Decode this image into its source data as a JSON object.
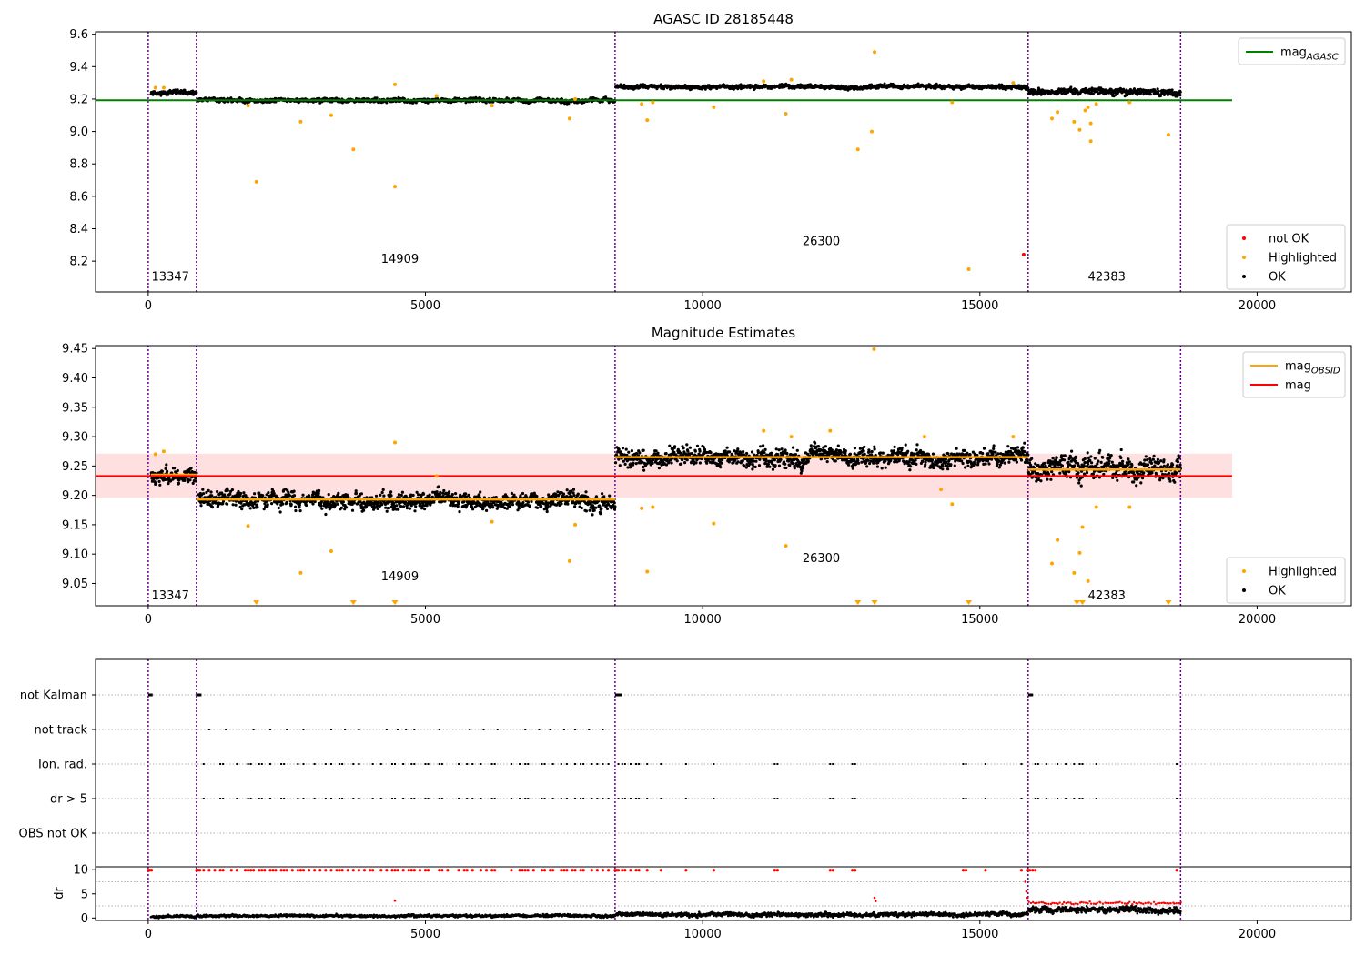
{
  "chart_data": [
    {
      "type": "scatter",
      "title": "AGASC ID 28185448",
      "xlim": [
        -950,
        21700
      ],
      "ylim": [
        8.01,
        9.615
      ],
      "xticks": [
        0,
        5000,
        10000,
        15000,
        20000
      ],
      "yticks": [
        8.2,
        8.4,
        8.6,
        8.8,
        9.0,
        9.2,
        9.4,
        9.6
      ],
      "vlines": [
        0,
        870,
        8420,
        15870,
        18620
      ],
      "obsids": [
        {
          "label": "13347",
          "x": 60,
          "y": 8.08
        },
        {
          "label": "14909",
          "x": 4200,
          "y": 8.19
        },
        {
          "label": "26300",
          "x": 11800,
          "y": 8.3
        },
        {
          "label": "42383",
          "x": 16950,
          "y": 8.08
        }
      ],
      "lines": [
        {
          "name": "mag_AGASC",
          "color": "#008000",
          "x": [
            -950,
            19550
          ],
          "y": [
            9.193,
            9.193
          ]
        }
      ],
      "ok_segments": [
        {
          "x0": 50,
          "x1": 870,
          "center": 9.24,
          "spread": 0.014
        },
        {
          "x0": 900,
          "x1": 8420,
          "center": 9.192,
          "spread": 0.014
        },
        {
          "x0": 8430,
          "x1": 15870,
          "center": 9.275,
          "spread": 0.014
        },
        {
          "x0": 15880,
          "x1": 18620,
          "center": 9.245,
          "spread": 0.022
        }
      ],
      "highlighted": [
        [
          130,
          9.27
        ],
        [
          280,
          9.27
        ],
        [
          1950,
          8.69
        ],
        [
          2750,
          9.06
        ],
        [
          3300,
          9.1
        ],
        [
          3700,
          8.89
        ],
        [
          4450,
          9.29
        ],
        [
          4450,
          8.66
        ],
        [
          1800,
          9.16
        ],
        [
          5200,
          9.22
        ],
        [
          6200,
          9.16
        ],
        [
          7600,
          9.08
        ],
        [
          7700,
          9.2
        ],
        [
          8900,
          9.17
        ],
        [
          9000,
          9.07
        ],
        [
          9100,
          9.18
        ],
        [
          10200,
          9.15
        ],
        [
          11100,
          9.31
        ],
        [
          11500,
          9.11
        ],
        [
          11600,
          9.32
        ],
        [
          12800,
          8.89
        ],
        [
          13050,
          9.0
        ],
        [
          13100,
          9.49
        ],
        [
          14500,
          9.18
        ],
        [
          14800,
          8.15
        ],
        [
          15600,
          9.3
        ],
        [
          16300,
          9.08
        ],
        [
          16400,
          9.12
        ],
        [
          16700,
          9.06
        ],
        [
          16800,
          9.01
        ],
        [
          16900,
          9.13
        ],
        [
          16950,
          9.15
        ],
        [
          17000,
          8.94
        ],
        [
          17000,
          9.05
        ],
        [
          17100,
          9.17
        ],
        [
          17700,
          9.18
        ],
        [
          18400,
          8.98
        ]
      ],
      "not_ok": [
        [
          15790,
          8.24
        ]
      ],
      "legends": [
        {
          "position": "upper-right",
          "entries": [
            {
              "label": "mag",
              "sub": "AGASC",
              "color": "#008000",
              "kind": "line"
            }
          ]
        },
        {
          "position": "lower-right",
          "entries": [
            {
              "label": "not OK",
              "color": "#ff0000",
              "kind": "dot"
            },
            {
              "label": "Highlighted",
              "color": "#ffa500",
              "kind": "dot"
            },
            {
              "label": "OK",
              "color": "#000000",
              "kind": "dot"
            }
          ]
        }
      ]
    },
    {
      "type": "scatter",
      "title": "Magnitude Estimates",
      "xlim": [
        -950,
        21700
      ],
      "ylim": [
        9.012,
        9.455
      ],
      "xticks": [
        0,
        5000,
        10000,
        15000,
        20000
      ],
      "yticks": [
        9.05,
        9.1,
        9.15,
        9.2,
        9.25,
        9.3,
        9.35,
        9.4,
        9.45
      ],
      "vlines": [
        0,
        870,
        8420,
        15870,
        18620
      ],
      "obsids": [
        {
          "label": "13347",
          "x": 60,
          "y": 9.023
        },
        {
          "label": "14909",
          "x": 4200,
          "y": 9.055
        },
        {
          "label": "26300",
          "x": 11800,
          "y": 9.086
        },
        {
          "label": "42383",
          "x": 16950,
          "y": 9.023
        }
      ],
      "mag": {
        "value": 9.233,
        "band": [
          9.196,
          9.271
        ],
        "xrange": [
          -950,
          19550
        ],
        "color": "#ff0000"
      },
      "mag_obsid": [
        {
          "x0": 50,
          "x1": 870,
          "y": 9.235
        },
        {
          "x0": 870,
          "x1": 8420,
          "y": 9.193
        },
        {
          "x0": 8420,
          "x1": 15870,
          "y": 9.265
        },
        {
          "x0": 15870,
          "x1": 18620,
          "y": 9.244
        }
      ],
      "ok_segments": [
        {
          "x0": 50,
          "x1": 870,
          "center": 9.235,
          "spread": 0.015
        },
        {
          "x0": 900,
          "x1": 8420,
          "center": 9.192,
          "spread": 0.016
        },
        {
          "x0": 8430,
          "x1": 15870,
          "center": 9.265,
          "spread": 0.017
        },
        {
          "x0": 15880,
          "x1": 18620,
          "center": 9.244,
          "spread": 0.024
        }
      ],
      "highlighted": [
        [
          130,
          9.27
        ],
        [
          280,
          9.275
        ],
        [
          1800,
          9.148
        ],
        [
          2750,
          9.068
        ],
        [
          3300,
          9.105
        ],
        [
          4450,
          9.29
        ],
        [
          5200,
          9.233
        ],
        [
          6200,
          9.155
        ],
        [
          7600,
          9.088
        ],
        [
          7700,
          9.15
        ],
        [
          8900,
          9.178
        ],
        [
          9000,
          9.07
        ],
        [
          9100,
          9.18
        ],
        [
          10200,
          9.152
        ],
        [
          11100,
          9.31
        ],
        [
          11500,
          9.114
        ],
        [
          11600,
          9.3
        ],
        [
          12300,
          9.31
        ],
        [
          14000,
          9.3
        ],
        [
          14300,
          9.21
        ],
        [
          14500,
          9.185
        ],
        [
          15600,
          9.3
        ],
        [
          16300,
          9.084
        ],
        [
          16400,
          9.124
        ],
        [
          16700,
          9.068
        ],
        [
          16800,
          9.102
        ],
        [
          16850,
          9.146
        ],
        [
          16950,
          9.054
        ],
        [
          17100,
          9.18
        ],
        [
          17700,
          9.18
        ],
        [
          13090,
          9.449
        ]
      ],
      "below_range": [
        1950,
        3700,
        4450,
        12800,
        13100,
        14800,
        16750,
        16850,
        18400
      ],
      "legends": [
        {
          "position": "upper-right",
          "entries": [
            {
              "label": "mag",
              "sub": "OBSID",
              "color": "#ffa500",
              "kind": "line"
            },
            {
              "label": "mag",
              "color": "#ff0000",
              "kind": "line"
            }
          ]
        },
        {
          "position": "lower-right",
          "entries": [
            {
              "label": "Highlighted",
              "color": "#ffa500",
              "kind": "dot"
            },
            {
              "label": "OK",
              "color": "#000000",
              "kind": "dot"
            }
          ]
        }
      ]
    },
    {
      "type": "scatter",
      "title": "",
      "xlim": [
        -950,
        21700
      ],
      "vlines": [
        0,
        870,
        8420,
        15870,
        18620
      ],
      "categories": [
        "not Kalman",
        "not track",
        "Ion. rad.",
        "dr > 5",
        "OBS not OK"
      ],
      "flags": {
        "not Kalman": [
          [
            0,
            80
          ],
          [
            860,
            960
          ],
          [
            8420,
            8540
          ],
          [
            15870,
            15960
          ]
        ],
        "not track": [
          1100,
          1400,
          1900,
          2200,
          2500,
          2800,
          3300,
          3550,
          3800,
          4300,
          4500,
          4650,
          4800,
          5250,
          5800,
          6050,
          6300,
          6800,
          7050,
          7250,
          7500,
          7700,
          7950,
          8200
        ],
        "Ion. rad.": [
          1000,
          1300,
          1350,
          1600,
          1800,
          1850,
          2000,
          2050,
          2200,
          2400,
          2450,
          2700,
          2800,
          3000,
          3200,
          3300,
          3450,
          3500,
          3700,
          3800,
          4050,
          4200,
          4400,
          4450,
          4600,
          4750,
          4800,
          5000,
          5050,
          5250,
          5300,
          5600,
          5750,
          5850,
          6000,
          6200,
          6250,
          6550,
          6700,
          6800,
          6850,
          7100,
          7150,
          7300,
          7450,
          7550,
          7700,
          7800,
          7850,
          8000,
          8100,
          8200,
          8300,
          8480,
          8550,
          8600,
          8700,
          8800,
          8850,
          9000,
          9250,
          9700,
          10200,
          11300,
          11350,
          12300,
          12350,
          12700,
          12750,
          14700,
          14750,
          15100,
          15750,
          16000,
          16050,
          16200,
          16400,
          16550,
          16700,
          16800,
          16850,
          17100,
          18550
        ],
        "dr": [
          1000,
          1300,
          1350,
          1600,
          1800,
          1850,
          2000,
          2050,
          2200,
          2400,
          2450,
          2700,
          2800,
          3000,
          3200,
          3300,
          3450,
          3500,
          3700,
          3800,
          4050,
          4200,
          4400,
          4450,
          4600,
          4750,
          4800,
          5000,
          5050,
          5250,
          5300,
          5600,
          5750,
          5850,
          6000,
          6200,
          6250,
          6550,
          6700,
          6800,
          6850,
          7100,
          7150,
          7300,
          7450,
          7550,
          7700,
          7800,
          7850,
          8000,
          8100,
          8200,
          8300,
          8480,
          8550,
          8600,
          8700,
          8800,
          8850,
          9000,
          9250,
          9700,
          10200,
          11300,
          11350,
          12300,
          12350,
          12700,
          12750,
          14700,
          14750,
          15100,
          15750,
          16000,
          16050,
          16200,
          16400,
          16550,
          16700,
          16800,
          16850,
          17100,
          18550
        ]
      },
      "color": "#000000"
    },
    {
      "type": "scatter",
      "ylabel": "dr",
      "xlim": [
        -950,
        21700
      ],
      "ylim": [
        -0.5,
        10.6
      ],
      "xticks": [
        0,
        5000,
        10000,
        15000,
        20000
      ],
      "yticks": [
        0,
        5,
        10
      ],
      "vlines": [
        0,
        870,
        8420,
        15870,
        18620
      ],
      "red_top": [
        0,
        30,
        60,
        870,
        900,
        930,
        1000,
        1100,
        1200,
        1300,
        1350,
        1500,
        1600,
        1750,
        1800,
        1850,
        1900,
        2000,
        2050,
        2100,
        2200,
        2250,
        2300,
        2400,
        2450,
        2500,
        2600,
        2700,
        2750,
        2800,
        2900,
        3000,
        3100,
        3200,
        3300,
        3400,
        3450,
        3500,
        3600,
        3700,
        3800,
        3900,
        4000,
        4050,
        4200,
        4300,
        4400,
        4450,
        4500,
        4600,
        4700,
        4750,
        4800,
        4900,
        5000,
        5050,
        5250,
        5300,
        5400,
        5600,
        5700,
        5750,
        5850,
        6000,
        6100,
        6200,
        6250,
        6550,
        6700,
        6750,
        6800,
        6850,
        6950,
        7100,
        7150,
        7250,
        7300,
        7450,
        7500,
        7550,
        7650,
        7700,
        7800,
        7850,
        8000,
        8100,
        8200,
        8300,
        8420,
        8450,
        8480,
        8550,
        8600,
        8700,
        8800,
        8850,
        9000,
        9250,
        9700,
        10200,
        11300,
        11350,
        12300,
        12350,
        12700,
        12750,
        14700,
        14750,
        15100,
        15750,
        15870,
        15900,
        15950,
        16000,
        18550
      ],
      "red_scatter": [
        [
          4450,
          3.6
        ],
        [
          13100,
          4.2
        ],
        [
          13120,
          3.5
        ],
        [
          15820,
          7.5
        ],
        [
          15840,
          5.5
        ],
        [
          15860,
          4.2
        ]
      ],
      "ok_segments": [
        {
          "x0": 50,
          "x1": 870,
          "center": 0.35,
          "spread": 0.25
        },
        {
          "x0": 900,
          "x1": 8420,
          "center": 0.45,
          "spread": 0.3
        },
        {
          "x0": 8430,
          "x1": 15870,
          "center": 0.75,
          "spread": 0.45
        },
        {
          "x0": 15880,
          "x1": 18620,
          "center": 1.7,
          "spread": 0.7
        }
      ],
      "red_band": {
        "x0": 15880,
        "x1": 18620,
        "center": 3.1,
        "spread": 0.35
      }
    }
  ]
}
